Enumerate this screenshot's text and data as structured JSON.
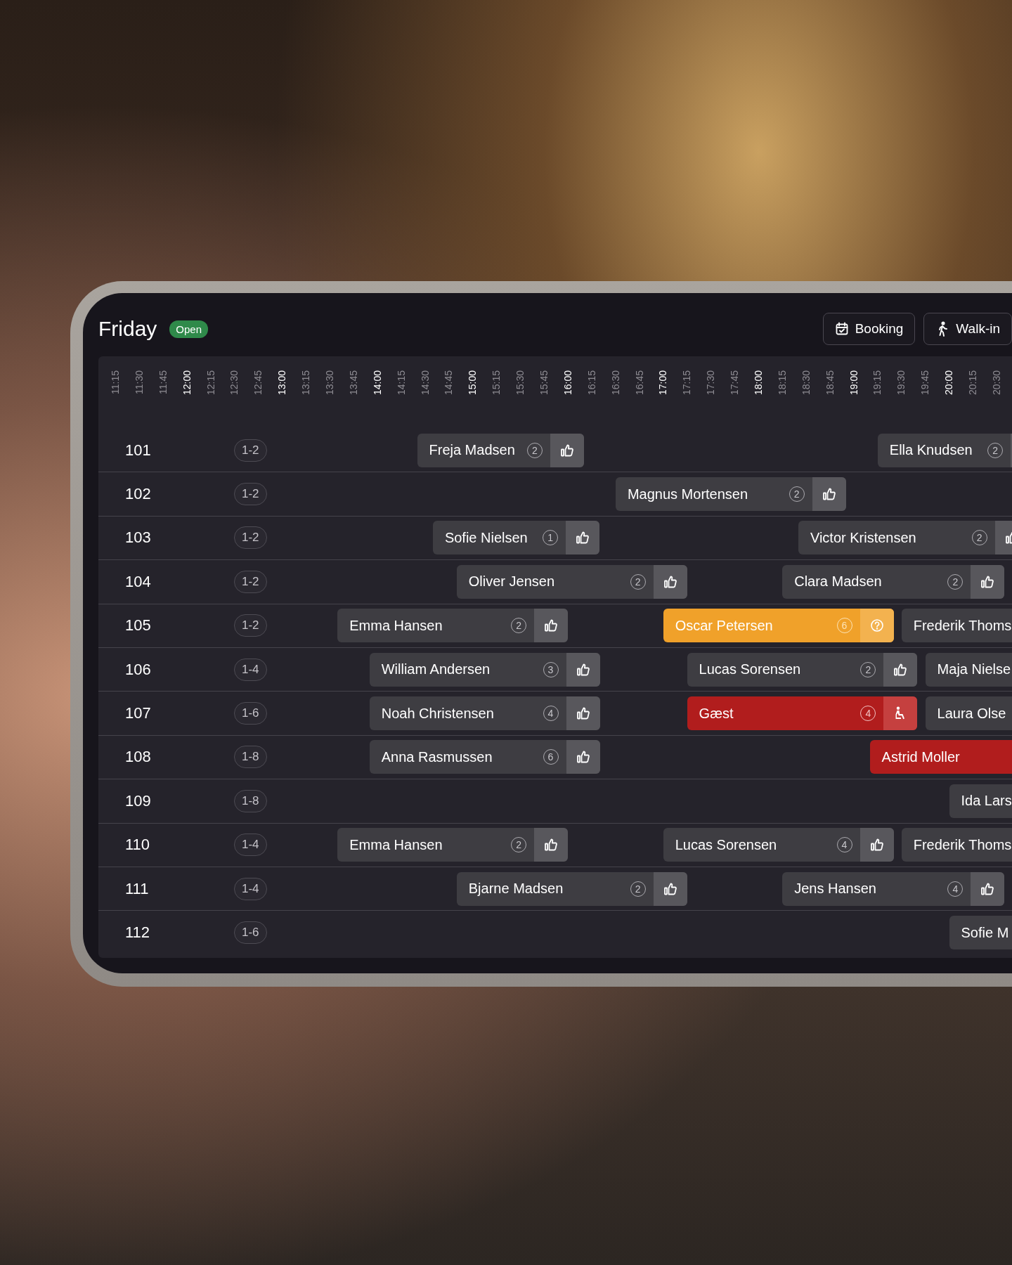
{
  "header": {
    "title": "Friday",
    "status_badge": "Open",
    "buttons": [
      {
        "label": "Booking",
        "kind": "booking"
      },
      {
        "label": "Walk-in",
        "kind": "walkin"
      }
    ]
  },
  "timeline": [
    {
      "label": "11:15",
      "major": false
    },
    {
      "label": "11:30",
      "major": false
    },
    {
      "label": "11:45",
      "major": false
    },
    {
      "label": "12:00",
      "major": true
    },
    {
      "label": "12:15",
      "major": false
    },
    {
      "label": "12:30",
      "major": false
    },
    {
      "label": "12:45",
      "major": false
    },
    {
      "label": "13:00",
      "major": true
    },
    {
      "label": "13:15",
      "major": false
    },
    {
      "label": "13:30",
      "major": false
    },
    {
      "label": "13:45",
      "major": false
    },
    {
      "label": "14:00",
      "major": true
    },
    {
      "label": "14:15",
      "major": false
    },
    {
      "label": "14:30",
      "major": false
    },
    {
      "label": "14:45",
      "major": false
    },
    {
      "label": "15:00",
      "major": true
    },
    {
      "label": "15:15",
      "major": false
    },
    {
      "label": "15:30",
      "major": false
    },
    {
      "label": "15:45",
      "major": false
    },
    {
      "label": "16:00",
      "major": true
    },
    {
      "label": "16:15",
      "major": false
    },
    {
      "label": "16:30",
      "major": false
    },
    {
      "label": "16:45",
      "major": false
    },
    {
      "label": "17:00",
      "major": true
    },
    {
      "label": "17:15",
      "major": false
    },
    {
      "label": "17:30",
      "major": false
    },
    {
      "label": "17:45",
      "major": false
    },
    {
      "label": "18:00",
      "major": true
    },
    {
      "label": "18:15",
      "major": false
    },
    {
      "label": "18:30",
      "major": false
    },
    {
      "label": "18:45",
      "major": false
    },
    {
      "label": "19:00",
      "major": true
    },
    {
      "label": "19:15",
      "major": false
    },
    {
      "label": "19:30",
      "major": false
    },
    {
      "label": "19:45",
      "major": false
    },
    {
      "label": "20:00",
      "major": true
    },
    {
      "label": "20:15",
      "major": false
    },
    {
      "label": "20:30",
      "major": false
    }
  ],
  "tables": [
    {
      "number": "101",
      "capacity": "1-2",
      "bookings": [
        {
          "name": "Freja Madsen",
          "guests": "2",
          "kind": "confirmed"
        },
        {
          "name": "Ella Knudsen",
          "guests": "2",
          "kind": "confirmed"
        }
      ]
    },
    {
      "number": "102",
      "capacity": "1-2",
      "bookings": [
        {
          "name": "Magnus Mortensen",
          "guests": "2",
          "kind": "confirmed"
        }
      ]
    },
    {
      "number": "103",
      "capacity": "1-2",
      "bookings": [
        {
          "name": "Sofie Nielsen",
          "guests": "1",
          "kind": "confirmed"
        },
        {
          "name": "Victor Kristensen",
          "guests": "2",
          "kind": "confirmed"
        }
      ]
    },
    {
      "number": "104",
      "capacity": "1-2",
      "bookings": [
        {
          "name": "Oliver Jensen",
          "guests": "2",
          "kind": "confirmed"
        },
        {
          "name": "Clara Madsen",
          "guests": "2",
          "kind": "confirmed"
        }
      ]
    },
    {
      "number": "105",
      "capacity": "1-2",
      "bookings": [
        {
          "name": "Emma Hansen",
          "guests": "2",
          "kind": "confirmed"
        },
        {
          "name": "Oscar Petersen",
          "guests": "6",
          "kind": "pending"
        },
        {
          "name": "Frederik Thoms",
          "kind": "confirmed"
        }
      ]
    },
    {
      "number": "106",
      "capacity": "1-4",
      "bookings": [
        {
          "name": "William Andersen",
          "guests": "3",
          "kind": "confirmed"
        },
        {
          "name": "Lucas Sorensen",
          "guests": "2",
          "kind": "confirmed"
        },
        {
          "name": "Maja Nielse",
          "kind": "confirmed"
        }
      ]
    },
    {
      "number": "107",
      "capacity": "1-6",
      "bookings": [
        {
          "name": "Noah Christensen",
          "guests": "4",
          "kind": "confirmed"
        },
        {
          "name": "Gæst",
          "guests": "4",
          "kind": "seated"
        },
        {
          "name": "Laura Olse",
          "kind": "confirmed"
        }
      ]
    },
    {
      "number": "108",
      "capacity": "1-8",
      "bookings": [
        {
          "name": "Anna Rasmussen",
          "guests": "6",
          "kind": "confirmed"
        },
        {
          "name": "Astrid Moller",
          "kind": "seated"
        }
      ]
    },
    {
      "number": "109",
      "capacity": "1-8",
      "bookings": [
        {
          "name": "Ida Lars",
          "kind": "confirmed"
        }
      ]
    },
    {
      "number": "110",
      "capacity": "1-4",
      "bookings": [
        {
          "name": "Emma Hansen",
          "guests": "2",
          "kind": "confirmed"
        },
        {
          "name": "Lucas Sorensen",
          "guests": "4",
          "kind": "confirmed"
        },
        {
          "name": "Frederik Thoms",
          "kind": "confirmed"
        }
      ]
    },
    {
      "number": "111",
      "capacity": "1-4",
      "bookings": [
        {
          "name": "Bjarne Madsen",
          "guests": "2",
          "kind": "confirmed"
        },
        {
          "name": "Jens Hansen",
          "guests": "4",
          "kind": "confirmed"
        }
      ]
    },
    {
      "number": "112",
      "capacity": "1-6",
      "bookings": [
        {
          "name": "Sofie M",
          "kind": "confirmed"
        }
      ]
    }
  ]
}
